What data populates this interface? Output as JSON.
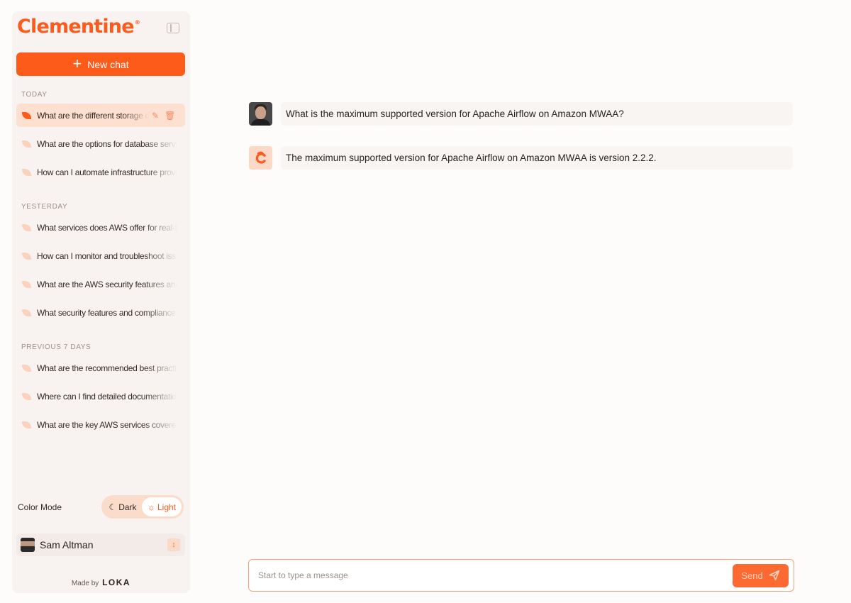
{
  "app": {
    "brand": "Clementine",
    "brand_mark": "®",
    "accent": "#fd5b1a"
  },
  "sidebar": {
    "new_chat_label": "New chat",
    "sections": [
      {
        "title": "TODAY",
        "items": [
          "What are the different storage options",
          "What are the options for database services",
          "How can I automate infrastructure provisioning"
        ]
      },
      {
        "title": "YESTERDAY",
        "items": [
          "What services does AWS offer for real-time",
          "How can I monitor and troubleshoot issues",
          "What are the AWS security features and",
          "What security features and compliance"
        ]
      },
      {
        "title": "PREVIOUS 7 DAYS",
        "items": [
          "What are the recommended best practices",
          "Where can I find detailed documentation",
          "What are the key AWS services covered"
        ]
      }
    ],
    "color_mode": {
      "label": "Color Mode",
      "dark": "Dark",
      "light": "Light",
      "selected": "Light"
    },
    "user": {
      "name": "Sam Altman"
    },
    "made_by": {
      "prefix": "Made by",
      "company": "LOKA"
    }
  },
  "chat": {
    "messages": [
      {
        "role": "user",
        "text": "What is the maximum supported version for Apache Airflow on Amazon MWAA?"
      },
      {
        "role": "assistant",
        "text": "The maximum supported version for Apache Airflow on Amazon MWAA is version 2.2.2."
      }
    ],
    "composer": {
      "placeholder": "Start to type a message",
      "send_label": "Send"
    }
  }
}
